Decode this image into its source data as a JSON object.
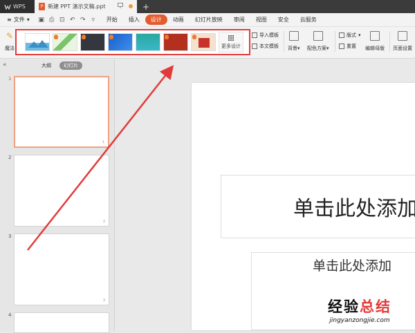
{
  "titlebar": {
    "app_tab": "WPS",
    "doc_tab": "新建 PPT 演示文稿.ppt",
    "doc_badge": "P",
    "new_tab": "+"
  },
  "menubar": {
    "file_label": "文件",
    "tabs": [
      {
        "label": "开始"
      },
      {
        "label": "插入"
      },
      {
        "label": "设计",
        "active": true
      },
      {
        "label": "动画"
      },
      {
        "label": "幻灯片放映"
      },
      {
        "label": "审阅"
      },
      {
        "label": "视图"
      },
      {
        "label": "安全"
      },
      {
        "label": "云服务"
      }
    ]
  },
  "ribbon": {
    "magic_label": "魔法",
    "more_design": "更多设计",
    "import_template": "导入模板",
    "text_template": "本文模板",
    "background": "背景",
    "color_scheme": "配色方案",
    "layout": "版式",
    "reset": "重置",
    "edit_master": "编辑母版",
    "page_setup": "页面设置"
  },
  "panel": {
    "tab_outline": "大纲",
    "tab_slides": "幻灯片",
    "slides": [
      {
        "num": "1",
        "small": "1"
      },
      {
        "num": "2",
        "small": "2"
      },
      {
        "num": "3",
        "small": "3"
      },
      {
        "num": "4",
        "small": ""
      }
    ]
  },
  "slide": {
    "title_placeholder": "单击此处添加",
    "subtitle_placeholder": "单击此处添加"
  },
  "watermark": {
    "text_a": "经验",
    "text_b": "总结",
    "url": "jingyanzongjie.com"
  },
  "colors": {
    "accent": "#e25c2f",
    "highlight_box": "#e23a3a",
    "arrow": "#e23a3a"
  }
}
